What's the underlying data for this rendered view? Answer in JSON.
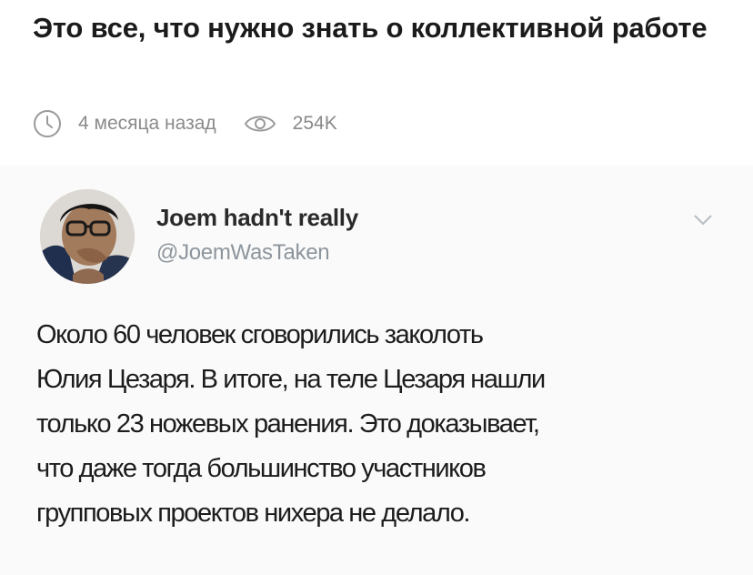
{
  "post": {
    "title": "Это все, что нужно знать о коллективной работе",
    "time_ago": "4 месяца назад",
    "views": "254K",
    "icons": {
      "time": "clock-icon",
      "views": "eye-icon"
    }
  },
  "tweet": {
    "author_name": "Joem hadn't really",
    "author_handle": "@JoemWasTaken",
    "text": "Около 60 человек сговорились заколоть\nЮлия Цезаря. В итоге, на теле Цезаря нашли\nтолько 23 ножевых ранения. Это доказывает,\nчто даже тогда большинство участников\nгрупповых проектов нихера не делало.",
    "menu_icon": "chevron-down-icon"
  },
  "colors": {
    "title": "#1b1b1b",
    "meta": "#8a8a8a",
    "handle": "#8d959c",
    "tweet_background": "#fafafa"
  }
}
